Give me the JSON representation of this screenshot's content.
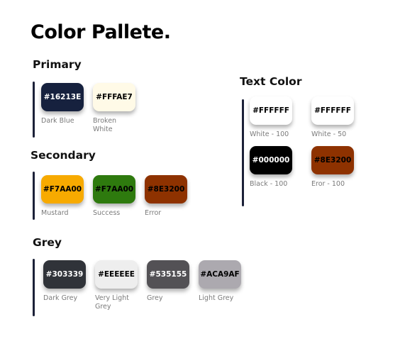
{
  "title": "Color Pallete.",
  "sections": {
    "primary": {
      "heading": "Primary",
      "swatches": [
        {
          "hex": "#16213E",
          "name": "Dark Blue",
          "text": "#ffffff"
        },
        {
          "hex": "#FFFAE7",
          "name": "Broken White",
          "text": "#000000"
        }
      ]
    },
    "secondary": {
      "heading": "Secondary",
      "swatches": [
        {
          "hex": "#F7AA00",
          "name": "Mustard",
          "text": "#000000",
          "fill": "#F7AA00"
        },
        {
          "hex": "#F7AA00",
          "name": "Success",
          "text": "#000000",
          "fill": "#2E7A0E"
        },
        {
          "hex": "#8E3200",
          "name": "Error",
          "text": "#000000",
          "fill": "#8E3200"
        }
      ]
    },
    "grey": {
      "heading": "Grey",
      "swatches": [
        {
          "hex": "#303339",
          "name": "Dark Grey",
          "text": "#ffffff"
        },
        {
          "hex": "#EEEEEE",
          "name": "Very Light Grey",
          "text": "#000000"
        },
        {
          "hex": "#535155",
          "name": "Grey",
          "text": "#ffffff"
        },
        {
          "hex": "#ACA9AF",
          "name": "Light Grey",
          "text": "#000000"
        }
      ]
    },
    "text_color": {
      "heading": "Text Color",
      "swatches": [
        {
          "hex": "#FFFFFF",
          "name": "White - 100",
          "text": "#000000"
        },
        {
          "hex": "#FFFFFF",
          "name": "White - 50",
          "text": "#000000"
        },
        {
          "hex": "#000000",
          "name": "Black - 100",
          "text": "#ffffff"
        },
        {
          "hex": "#8E3200",
          "name": "Eror - 100",
          "text": "#000000"
        }
      ]
    }
  }
}
